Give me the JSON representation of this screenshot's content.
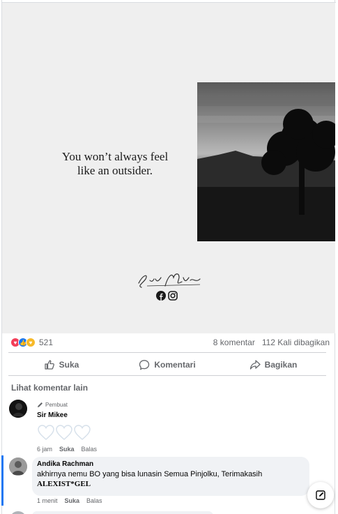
{
  "post": {
    "quote_line1": "You won’t always feel",
    "quote_line2": "like an outsider.",
    "signature": "Sir Mikee",
    "social_icons": [
      "facebook-icon",
      "instagram-icon"
    ]
  },
  "stats": {
    "reaction_icons": [
      "love-reaction-icon",
      "like-reaction-icon",
      "care-reaction-icon"
    ],
    "reaction_count": "521",
    "comments": "8 komentar",
    "shares": "112 Kali dibagikan"
  },
  "actions": {
    "like": "Suka",
    "comment": "Komentari",
    "share": "Bagikan"
  },
  "comments_section": {
    "view_more": "Lihat komentar lain",
    "comments": [
      {
        "badge": "Pembuat",
        "name": "Sir Mikee",
        "content": "three white hearts",
        "time": "6 jam",
        "like": "Suka",
        "reply": "Balas"
      },
      {
        "name": "Andika Rachman",
        "text": "akhirnya nemu BO yang bisa lunasin Semua Pinjolku, Terimakasih",
        "brand": "ALEXIST*GEL",
        "time": "1 menit",
        "like": "Suka",
        "reply": "Balas"
      }
    ]
  },
  "colors": {
    "accent": "#1877f2",
    "muted_text": "#65676b",
    "bubble": "#f0f2f5"
  }
}
